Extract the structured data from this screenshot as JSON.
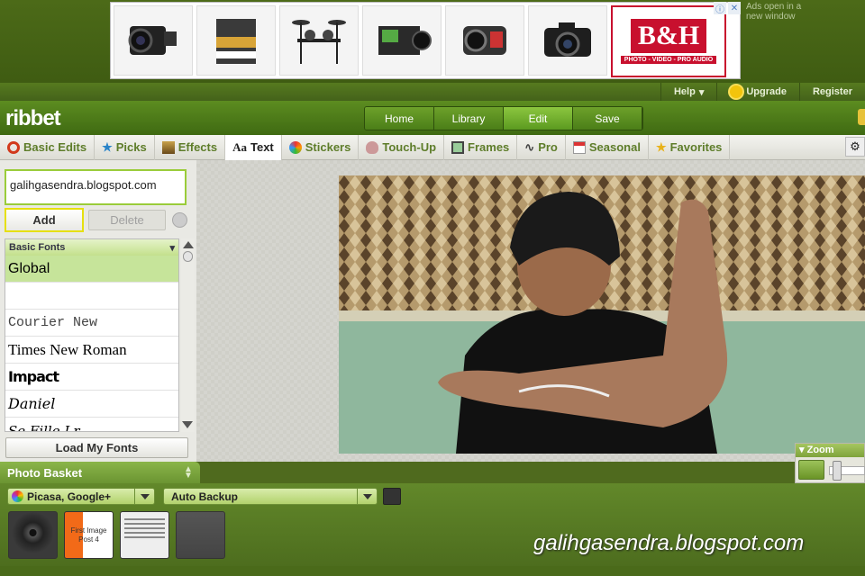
{
  "ad": {
    "ads_note": "Ads open in a new window",
    "brand_text": "B&H",
    "brand_tagline": "PHOTO - VIDEO - PRO AUDIO",
    "tiles": [
      "camcorder-product-icon",
      "producer-bundle-product-icon",
      "drum-kit-product-icon",
      "cinema-camera-product-icon",
      "dash-camera-product-icon",
      "dslr-camera-product-icon"
    ]
  },
  "account": {
    "help": "Help",
    "upgrade": "Upgrade",
    "register": "Register"
  },
  "app": {
    "logo": "ribbet"
  },
  "main_nav": [
    {
      "label": "Home"
    },
    {
      "label": "Library"
    },
    {
      "label": "Edit",
      "active": true
    },
    {
      "label": "Save"
    }
  ],
  "tool_tabs": [
    {
      "label": "Basic Edits",
      "icon": "basic-edits-icon"
    },
    {
      "label": "Picks",
      "icon": "star-icon"
    },
    {
      "label": "Effects",
      "icon": "effects-icon"
    },
    {
      "label": "Text",
      "icon": "text-icon",
      "icon_glyph": "Aa",
      "active": true
    },
    {
      "label": "Stickers",
      "icon": "stickers-icon"
    },
    {
      "label": "Touch-Up",
      "icon": "touch-up-icon"
    },
    {
      "label": "Frames",
      "icon": "frames-icon"
    },
    {
      "label": "Pro",
      "icon": "pro-curve-icon"
    },
    {
      "label": "Seasonal",
      "icon": "calendar-icon"
    },
    {
      "label": "Favorites",
      "icon": "star-icon"
    }
  ],
  "text_panel": {
    "input_value": "galihgasendra.blogspot.com",
    "add_label": "Add",
    "delete_label": "Delete",
    "font_category": "Basic Fonts",
    "fonts": [
      {
        "name": "Global",
        "selected": true
      },
      {
        "name": ""
      },
      {
        "name": "Courier New"
      },
      {
        "name": "Times New Roman"
      },
      {
        "name": "Impact"
      },
      {
        "name": "Daniel"
      },
      {
        "name": "Se Fille Lr"
      }
    ],
    "load_fonts_label": "Load My Fonts"
  },
  "zoom": {
    "label": "Zoom"
  },
  "basket": {
    "title": "Photo Basket",
    "source": "Picasa, Google+",
    "backup": "Auto Backup",
    "thumbs": [
      {
        "label": ""
      },
      {
        "label": "First Image Post 4"
      },
      {
        "label": ""
      },
      {
        "label": ""
      }
    ]
  },
  "watermark": "galihgasendra.blogspot.com",
  "colors": {
    "brand_green": "#5c8c20",
    "accent_yellow": "#e6e00f",
    "tab_text": "#5e7d2a"
  }
}
